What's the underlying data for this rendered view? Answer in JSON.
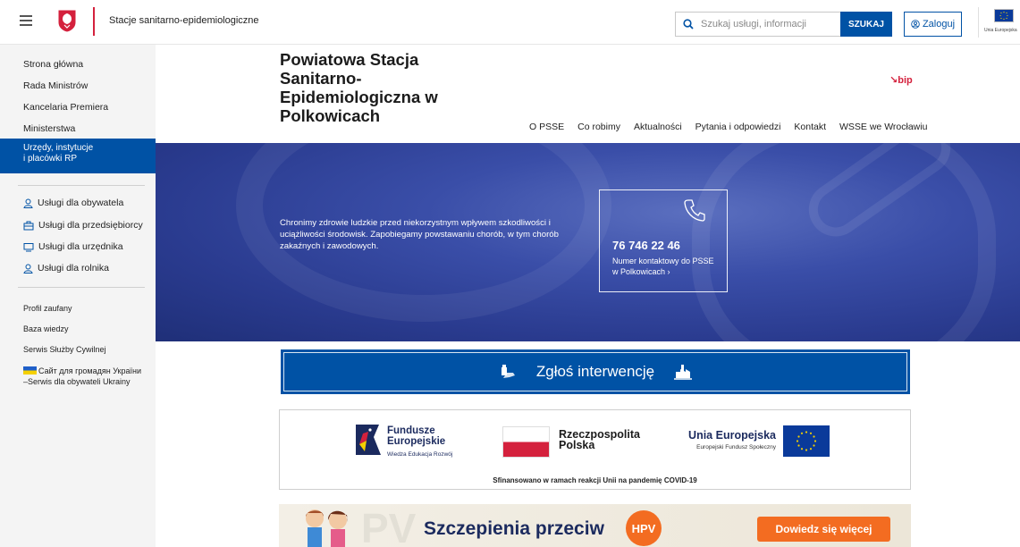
{
  "topbar": {
    "service_name": "Stacje sanitarno-epidemiologiczne",
    "search_placeholder": "Szukaj usługi, informacji",
    "search_button": "SZUKAJ",
    "login_button": "Zaloguj",
    "eu_label": "Unia Europejska"
  },
  "sidebar": {
    "items": [
      {
        "label": "Strona główna"
      },
      {
        "label": "Rada Ministrów"
      },
      {
        "label": "Kancelaria Premiera"
      },
      {
        "label": "Ministerstwa"
      }
    ],
    "active": {
      "line1": "Urzędy, instytucje",
      "line2": "i placówki RP"
    },
    "services": [
      {
        "label": "Usługi dla obywatela",
        "icon": "person-icon"
      },
      {
        "label": "Usługi dla przedsiębiorcy",
        "icon": "briefcase-icon"
      },
      {
        "label": "Usługi dla urzędnika",
        "icon": "monitor-icon"
      },
      {
        "label": "Usługi dla rolnika",
        "icon": "person-icon"
      }
    ],
    "small": [
      {
        "label": "Profil zaufany"
      },
      {
        "label": "Baza wiedzy"
      },
      {
        "label": "Serwis Służby Cywilnej"
      }
    ],
    "ukraine": {
      "line1": "Сайт для громадян України",
      "line2": "–Serwis dla obywateli Ukrainy"
    }
  },
  "header": {
    "title": "Powiatowa Stacja Sanitarno-Epidemiologiczna w Polkowicach",
    "bip": "bip",
    "nav": [
      "O PSSE",
      "Co robimy",
      "Aktualności",
      "Pytania i odpowiedzi",
      "Kontakt",
      "WSSE we Wrocławiu"
    ]
  },
  "hero": {
    "text": "Chronimy zdrowie ludzkie przed niekorzystnym wpływem szkodliwości i uciążliwości środowisk. Zapobiegamy powstawaniu chorób, w tym chorób zakaźnych i zawodowych.",
    "phone": "76 746 22 46",
    "phone_desc": "Numer kontaktowy do PSSE w Polkowicach ›"
  },
  "intervention": {
    "label": "Zgłoś interwencję"
  },
  "funding": {
    "fe_line1": "Fundusze",
    "fe_line2": "Europejskie",
    "fe_sub": "Wiedza Edukacja Rozwój",
    "pl_line1": "Rzeczpospolita",
    "pl_line2": "Polska",
    "ue_title": "Unia Europejska",
    "ue_sub": "Europejski Fundusz Społeczny",
    "caption": "Sfinansowano w ramach reakcji Unii na pandemię COVID-19"
  },
  "hpv_banner": {
    "title": "Szczepienia przeciw",
    "badge": "HPV",
    "ghost": "PV",
    "cta": "Dowiedz się więcej"
  },
  "colors": {
    "primary": "#0052a5",
    "gov_red": "#d4213d",
    "hpv_orange": "#f36c21"
  }
}
